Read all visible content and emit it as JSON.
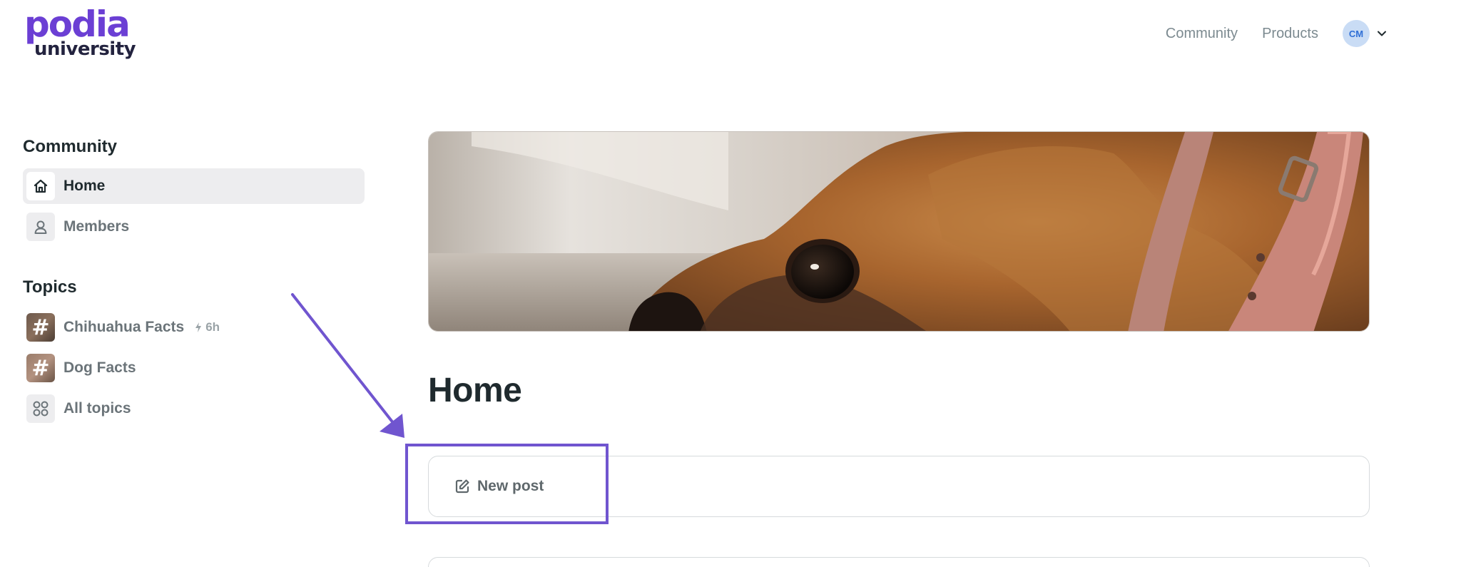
{
  "colors": {
    "brand_purple": "#6b3fd4",
    "logo_dark": "#23233f",
    "annotation_purple": "#7055cf",
    "avatar_bg": "#c9dcf5",
    "avatar_text": "#2f6fd6"
  },
  "logo": {
    "line1": "podia",
    "line2": "university"
  },
  "topnav": {
    "links": [
      "Community",
      "Products"
    ],
    "avatar_initials": "CM",
    "avatar_menu_icon": "chevron-down-icon"
  },
  "sidebar": {
    "community_heading": "Community",
    "community_items": [
      {
        "label": "Home",
        "icon": "home-icon",
        "active": true
      },
      {
        "label": "Members",
        "icon": "user-icon",
        "active": false
      }
    ],
    "topics_heading": "Topics",
    "topic_items": [
      {
        "label": "Chihuahua Facts",
        "icon": "hash-icon",
        "activity_icon": "lightning-icon",
        "activity": "6h"
      },
      {
        "label": "Dog Facts",
        "icon": "hash-icon"
      },
      {
        "label": "All topics",
        "icon": "grid-icon"
      }
    ]
  },
  "main": {
    "banner_icon": "chihuahua-photo",
    "title": "Home",
    "new_post_icon": "edit-icon",
    "new_post_label": "New post"
  }
}
